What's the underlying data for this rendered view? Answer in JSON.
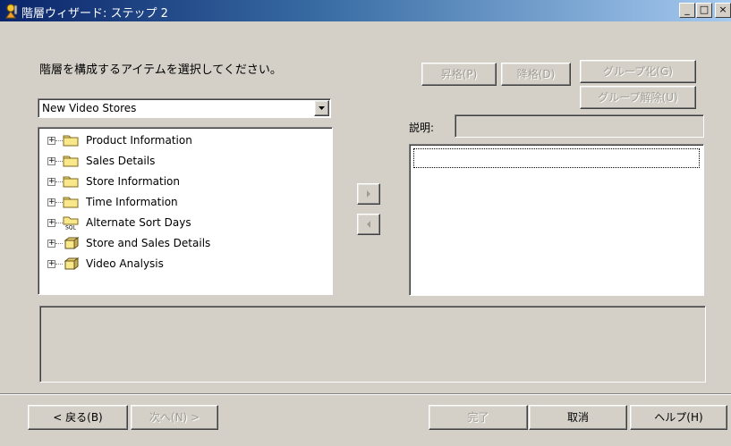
{
  "window": {
    "title": "階層ウィザード: ステップ 2",
    "icon": "wizard-icon",
    "controls": {
      "minimize": "_",
      "maximize": "□",
      "close": "×"
    }
  },
  "instruction": "階層を構成するアイテムを選択してください。",
  "toolbar": {
    "move_up": "昇格(P)",
    "move_down": "降格(D)",
    "group": "グループ化(G)",
    "ungroup": "グループ解除(U)"
  },
  "source_combo": {
    "value": "New Video Stores",
    "icon": "dropdown-arrow-icon"
  },
  "tree": {
    "items": [
      {
        "label": "Product Information",
        "icon": "folder-icon"
      },
      {
        "label": "Sales Details",
        "icon": "folder-icon"
      },
      {
        "label": "Store Information",
        "icon": "folder-icon"
      },
      {
        "label": "Time Information",
        "icon": "folder-icon"
      },
      {
        "label": "Alternate Sort Days",
        "icon": "sql-folder-icon"
      },
      {
        "label": "Store and Sales Details",
        "icon": "join-folder-icon"
      },
      {
        "label": "Video Analysis",
        "icon": "join-folder-icon"
      }
    ]
  },
  "description": {
    "label": "説明:",
    "value": ""
  },
  "footer": {
    "back": "< 戻る(B)",
    "next": "次へ(N) >",
    "finish": "完了",
    "cancel": "取消",
    "help": "ヘルプ(H)"
  },
  "colors": {
    "face": "#d4d0c8",
    "title_start": "#0a246a",
    "title_end": "#a6caf0",
    "disabled_text": "#a09c94"
  }
}
